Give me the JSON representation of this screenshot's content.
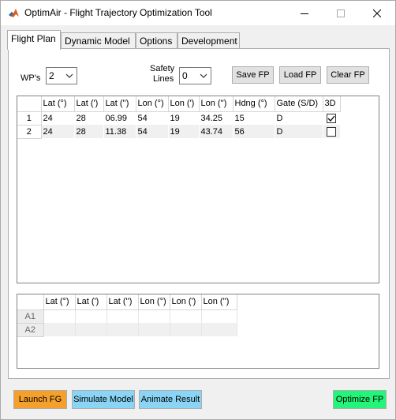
{
  "window": {
    "title": "OptimAir - Flight Trajectory Optimization Tool",
    "icon": "matlab-icon"
  },
  "tabs": [
    {
      "label": "Flight Plan",
      "active": true
    },
    {
      "label": "Dynamic Model",
      "active": false
    },
    {
      "label": "Options",
      "active": false
    },
    {
      "label": "Development",
      "active": false
    }
  ],
  "controls": {
    "wps_label": "WP's",
    "wps_value": "2",
    "safety_label_1": "Safety",
    "safety_label_2": "Lines",
    "safety_value": "0",
    "save_fp": "Save FP",
    "load_fp": "Load FP",
    "clear_fp": "Clear FP"
  },
  "waypoints": {
    "columns": [
      "Lat (°)",
      "Lat (')",
      "Lat ('')",
      "Lon (°)",
      "Lon (')",
      "Lon ('')",
      "Hdng (°)",
      "Gate (S/D)",
      "3D"
    ],
    "rows": [
      {
        "index": "1",
        "cells": [
          "24",
          "28",
          "06.99",
          "54",
          "19",
          "34.25",
          "15",
          "D"
        ],
        "three_d": true
      },
      {
        "index": "2",
        "cells": [
          "24",
          "28",
          "11.38",
          "54",
          "19",
          "43.74",
          "56",
          "D"
        ],
        "three_d": false
      }
    ]
  },
  "alternates": {
    "columns": [
      "Lat (°)",
      "Lat (')",
      "Lat ('')",
      "Lon (°)",
      "Lon (')",
      "Lon ('')"
    ],
    "rows": [
      {
        "index": "A1",
        "cells": [
          "",
          "",
          "",
          "",
          "",
          ""
        ]
      },
      {
        "index": "A2",
        "cells": [
          "",
          "",
          "",
          "",
          "",
          ""
        ]
      }
    ]
  },
  "actions": {
    "launch_fg": "Launch FG",
    "simulate_model": "Simulate Model",
    "animate_result": "Animate Result",
    "optimize_fp": "Optimize FP"
  },
  "colors": {
    "launch_fg": "#f5a02a",
    "simulate_model": "#8ad4f5",
    "animate_result": "#8ad4f5",
    "optimize_fp": "#22f57a"
  }
}
